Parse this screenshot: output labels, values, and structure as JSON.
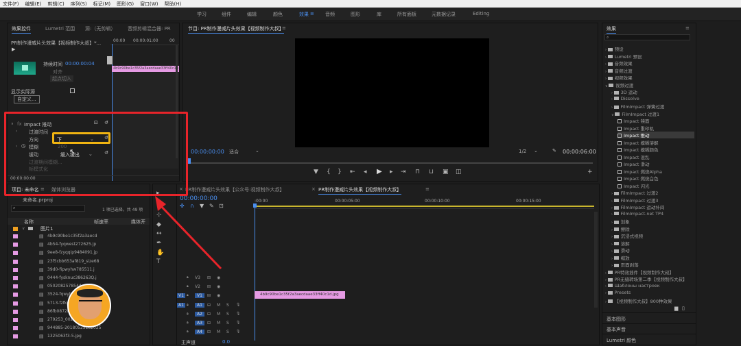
{
  "menubar": [
    "文件(F)",
    "编辑(E)",
    "剪辑(C)",
    "序列(S)",
    "标记(M)",
    "图形(G)",
    "窗口(W)",
    "帮助(H)"
  ],
  "workspaces": {
    "items": [
      "学习",
      "组件",
      "编辑",
      "颜色",
      "效果",
      "音频",
      "图形",
      "库",
      "所有面板",
      "元数据记录",
      "Editing"
    ],
    "active": "效果"
  },
  "effect_controls": {
    "tabs": [
      "效果控件",
      "Lumetri 范围",
      "源:（无剪辑）",
      "音频剪辑混合器: PR"
    ],
    "clip_title": "PR制作漫威片头效果【视频制作大叔】*...",
    "timecodes": [
      "00:00",
      "00:00:01:00",
      "00"
    ],
    "duration_label": "持续时间",
    "duration_value": "00:00:00:04",
    "align_label": "对齐",
    "align_value": "起点切入",
    "show_actual_source": "显示实际源",
    "custom_button": "自定义...",
    "clip_name": "4b9c90be1c35f2a3aecdaae33ff40c1b",
    "effect_name": "Impact 推动",
    "params": {
      "transition_time": "过渡时间",
      "direction": "方向",
      "direction_value": "下",
      "blur": "模糊",
      "blur_value": "200",
      "motion": "缓动",
      "motion_value": "缓入缓出",
      "filter_blur": "过渡期间模糊...",
      "slow_in": "帧模式化"
    },
    "current_time": "00:00:00:00"
  },
  "program_monitor": {
    "tab": "节目: PR制作漫威片头效果【视频制作大叔】",
    "timecode": "00:00:00:00",
    "fit": "适合",
    "ratio": "1/2",
    "duration": "00:00:06:00"
  },
  "effects_panel": {
    "title": "效果",
    "items": [
      {
        "label": "预设",
        "level": 0,
        "type": "folder"
      },
      {
        "label": "Lumetri 预设",
        "level": 0,
        "type": "folder"
      },
      {
        "label": "音频效果",
        "level": 0,
        "type": "folder"
      },
      {
        "label": "音频过渡",
        "level": 0,
        "type": "folder"
      },
      {
        "label": "视频效果",
        "level": 0,
        "type": "folder"
      },
      {
        "label": "视频过渡",
        "level": 0,
        "type": "folder"
      },
      {
        "label": "3D 运动",
        "level": 1,
        "type": "folder"
      },
      {
        "label": "Dissolve",
        "level": 1,
        "type": "folder"
      },
      {
        "label": "FilmImpact 弹簧过渡",
        "level": 1,
        "type": "folder"
      },
      {
        "label": "FilmImpact 过渡1",
        "level": 1,
        "type": "folder"
      },
      {
        "label": "Impact 镜面",
        "level": 2,
        "type": "fx"
      },
      {
        "label": "Impact 重印机",
        "level": 2,
        "type": "fx"
      },
      {
        "label": "Impact 推动",
        "level": 2,
        "type": "fx",
        "selected": true
      },
      {
        "label": "Impact 模糊溶解",
        "level": 2,
        "type": "fx"
      },
      {
        "label": "Impact 模糊颜色",
        "level": 2,
        "type": "fx"
      },
      {
        "label": "Impact 混乱",
        "level": 2,
        "type": "fx"
      },
      {
        "label": "Impact 滑动",
        "level": 2,
        "type": "fx"
      },
      {
        "label": "Impact 燃烧Alpha",
        "level": 2,
        "type": "fx"
      },
      {
        "label": "Impact 燃烧白色",
        "level": 2,
        "type": "fx"
      },
      {
        "label": "Impact 闪光",
        "level": 2,
        "type": "fx"
      },
      {
        "label": "FilmImpact 过渡2",
        "level": 1,
        "type": "folder"
      },
      {
        "label": "FilmImpact 过渡3",
        "level": 1,
        "type": "folder"
      },
      {
        "label": "FilmImpact 运动补间",
        "level": 1,
        "type": "folder"
      },
      {
        "label": "FilmImpact.net TP4",
        "level": 1,
        "type": "folder"
      },
      {
        "label": "划象",
        "level": 1,
        "type": "folder"
      },
      {
        "label": "擦除",
        "level": 1,
        "type": "folder"
      },
      {
        "label": "沉浸式视频",
        "level": 1,
        "type": "folder"
      },
      {
        "label": "溶解",
        "level": 1,
        "type": "folder"
      },
      {
        "label": "滑动",
        "level": 1,
        "type": "folder"
      },
      {
        "label": "缩放",
        "level": 1,
        "type": "folder"
      },
      {
        "label": "页面剥落",
        "level": 1,
        "type": "folder"
      },
      {
        "label": "PR特效插件【视频制作大叔】",
        "level": 0,
        "type": "folder"
      },
      {
        "label": "PR无缝转场第二季【视频制作大叔】",
        "level": 0,
        "type": "folder"
      },
      {
        "label": "Шаблоны настроек",
        "level": 0,
        "type": "folder"
      },
      {
        "label": "Presets",
        "level": 0,
        "type": "folder"
      },
      {
        "label": "【视频制作大叔】800种效果",
        "level": 0,
        "type": "folder"
      }
    ],
    "bottom": [
      "基本图形",
      "基本声音",
      "Lumetri 颜色"
    ]
  },
  "project_panel": {
    "tabs": [
      "项目: 未命名",
      "媒体浏览器"
    ],
    "file": "未命名.prproj",
    "selection_info": "1 项已选择，共 49 项",
    "columns": [
      "名称",
      "帧速率",
      "媒体开"
    ],
    "folder": "图片1",
    "files": [
      "4b9c90be1c35f2a3aecd",
      "4b54-fyqwest272625.jp",
      "9ee8-fzyqqip9484091.jp",
      "23f5cbb653af819_size68",
      "39d0-fipwyhw785511.j",
      "0444-fysknuc386263Q.j",
      "050208257854d",
      "3524-fqwyhw",
      "5713-fzfkpi",
      "86fb0872b08",
      "279253_002.jpg",
      "944885-20180525182025",
      "1325063f3-5.jpg"
    ]
  },
  "timeline": {
    "tabs": [
      "PR制作漫威片头效果【公众号:视频制作大叔】",
      "PR制作漫威片头效果【视频制作大叔】"
    ],
    "timecode": "00:00:00:00",
    "ruler": [
      ":00:00",
      "00:00:05:00",
      "00:00:10:00",
      "00:00:15:00"
    ],
    "video_tracks": [
      "V3",
      "V2",
      "V1"
    ],
    "audio_tracks": [
      "A1",
      "A2",
      "A3",
      "A4"
    ],
    "master": "主声道",
    "master_value": "0.0",
    "clip_label": "4b9c90be1c35f2a3aecdaae33ff40c1d.jpg",
    "src_v": "V1",
    "src_a": "A1"
  },
  "colors": {
    "accent": "#4a8ff0",
    "clip": "#e59ae3",
    "highlight_red": "#e8242a",
    "highlight_yellow": "#f0b412"
  }
}
